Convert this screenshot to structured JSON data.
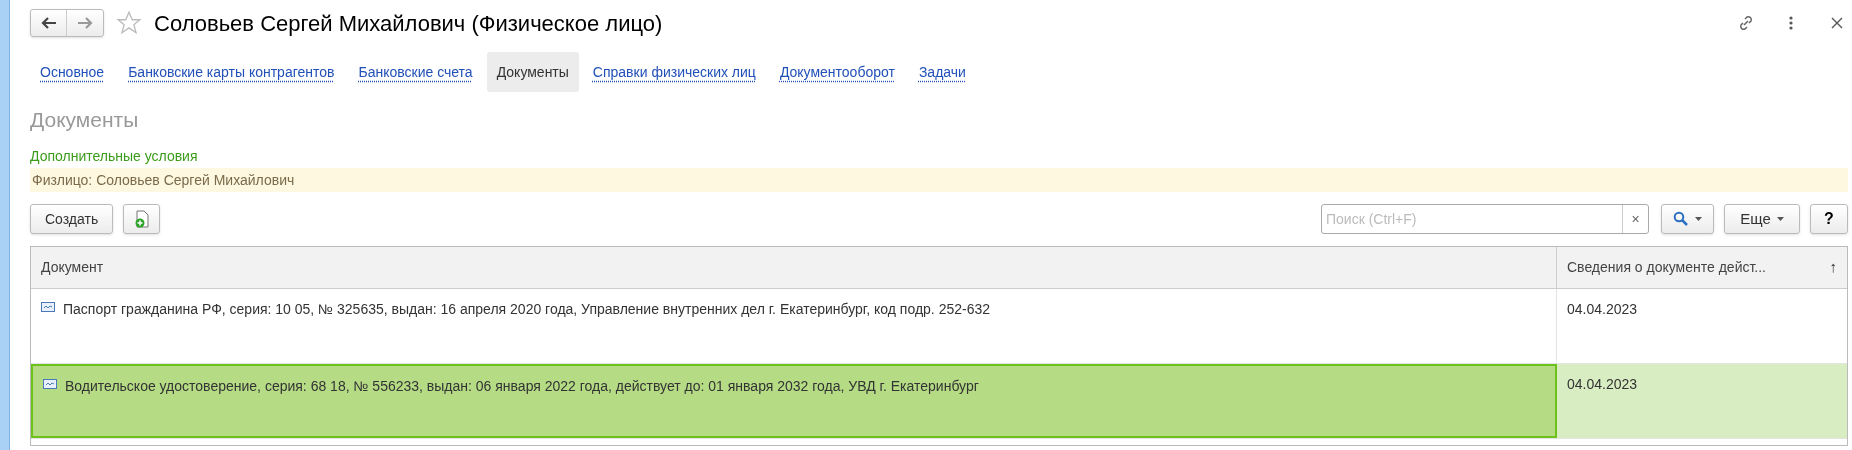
{
  "window": {
    "title": "Соловьев Сергей Михайлович (Физическое лицо)"
  },
  "tabs": [
    {
      "label": "Основное",
      "selected": false
    },
    {
      "label": "Банковские карты контрагентов",
      "selected": false
    },
    {
      "label": "Банковские счета",
      "selected": false
    },
    {
      "label": "Документы",
      "selected": true
    },
    {
      "label": "Справки физических лиц",
      "selected": false
    },
    {
      "label": "Документооборот",
      "selected": false
    },
    {
      "label": "Задачи",
      "selected": false
    }
  ],
  "section_title": "Документы",
  "conditions": {
    "title": "Дополнительные условия",
    "filter": "Физлицо: Соловьев Сергей Михайлович"
  },
  "toolbar": {
    "create_button": "Создать",
    "search": {
      "placeholder": "Поиск (Ctrl+F)"
    },
    "clear_button": "×",
    "more_button": "Еще",
    "help_button": "?"
  },
  "table": {
    "columns": [
      {
        "label": "Документ"
      },
      {
        "label": "Сведения о документе дейст...",
        "sort": "↑"
      }
    ],
    "rows": [
      {
        "document": "Паспорт гражданина РФ, серия: 10 05, № 325635, выдан: 16 апреля 2020 года, Управление внутренних дел г. Екатеринбург, код подр. 252-632",
        "date": "04.04.2023",
        "selected": false
      },
      {
        "document": "Водительское удостоверение, серия: 68 18, № 556233, выдан: 06 января 2022 года, действует до: 01 января 2032 года, УВД г. Екатеринбург",
        "date": "04.04.2023",
        "selected": true
      }
    ]
  }
}
